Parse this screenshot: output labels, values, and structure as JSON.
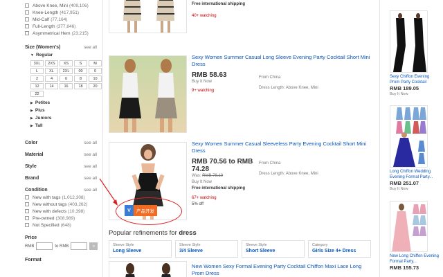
{
  "sidebar": {
    "length_filters": [
      {
        "label": "Above Knee, Mini",
        "count": "(409,106)"
      },
      {
        "label": "Knee-Length",
        "count": "(417,951)"
      },
      {
        "label": "Mid-Calf",
        "count": "(77,164)"
      },
      {
        "label": "Full-Length",
        "count": "(377,846)"
      },
      {
        "label": "Asymmetrical Hem",
        "count": "(23,215)"
      }
    ],
    "size_title": "Size (Women's)",
    "see_all": "see all",
    "regular_label": "Regular",
    "sizes": [
      "3XL",
      "2XS",
      "XS",
      "S",
      "M",
      "L",
      "XL",
      "2XL",
      "00",
      "0",
      "2",
      "4",
      "6",
      "8",
      "10",
      "12",
      "14",
      "16",
      "18",
      "20",
      "22"
    ],
    "size_groups": [
      "Petites",
      "Plus",
      "Juniors",
      "Tall"
    ],
    "sections": [
      "Color",
      "Material",
      "Style",
      "Brand"
    ],
    "condition_title": "Condition",
    "conditions": [
      {
        "label": "New with tags",
        "count": "(1,012,308)"
      },
      {
        "label": "New without tags",
        "count": "(403,262)"
      },
      {
        "label": "New with defects",
        "count": "(10,398)"
      },
      {
        "label": "Pre-owned",
        "count": "(308,989)"
      },
      {
        "label": "Not Specified",
        "count": "(648)"
      }
    ],
    "price_title": "Price",
    "price_from": "RMB",
    "price_to": "to RMB",
    "price_go": "»",
    "format_title": "Format"
  },
  "listings": [
    {
      "shipping": "Free international shipping",
      "watching": "40+ watching"
    },
    {
      "title": "Sexy Women Summer Casual Long Sleeve Evening Party Cocktail Short Mini Dress",
      "price": "RMB 58.63",
      "format": "Buy It Now",
      "watching": "9+ watching",
      "origin": "From China",
      "dress_length": "Dress Length: Above Knee, Mini"
    },
    {
      "title": "Sexy Women Summer Casual Sleeveless Party Evening Cocktail Short Mini Dress",
      "price": "RMB 70.56 to RMB 74.28",
      "was_label": "Was:",
      "was_price": "RMB 78.19",
      "format": "Buy It Now",
      "shipping": "Free international shipping",
      "watching": "67+ watching",
      "discount": "5% off",
      "origin": "From China",
      "dress_length": "Dress Length: Above Knee, Mini",
      "dev_badge_v": "V",
      "dev_badge_text": "产品开发"
    },
    {
      "title": "New Women Sexy Formal Evening Party Cocktail Chiffon Maxi Lace Long Prom Dress"
    }
  ],
  "popular": {
    "prefix": "Popular refinements for ",
    "keyword": "dress",
    "items": [
      {
        "label": "Sleeve Style",
        "value": "Long Sleeve"
      },
      {
        "label": "Sleeve Style",
        "value": "3/4 Sleeve"
      },
      {
        "label": "Sleeve Style",
        "value": "Short Sleeve"
      },
      {
        "label": "Category",
        "value": "Girls Size 4+ Dress"
      }
    ]
  },
  "rail": [
    {
      "title": "Sexy Chiffon Evening Prom Party Cocktail",
      "price": "RMB 189.05",
      "format": "Buy It Now"
    },
    {
      "title": "Long Chiffon Wedding Evening Formal Party...",
      "price": "RMB 251.07",
      "format": "Buy It Now"
    },
    {
      "title": "New Long Chiffon Evening Formal Party...",
      "price": "RMB 155.73",
      "format": ""
    }
  ],
  "colors": {
    "link": "#0654ba",
    "watching": "#cc0000",
    "annotation": "#e02020",
    "badge_blue": "#3a7bd5",
    "badge_orange": "#f26b22"
  }
}
